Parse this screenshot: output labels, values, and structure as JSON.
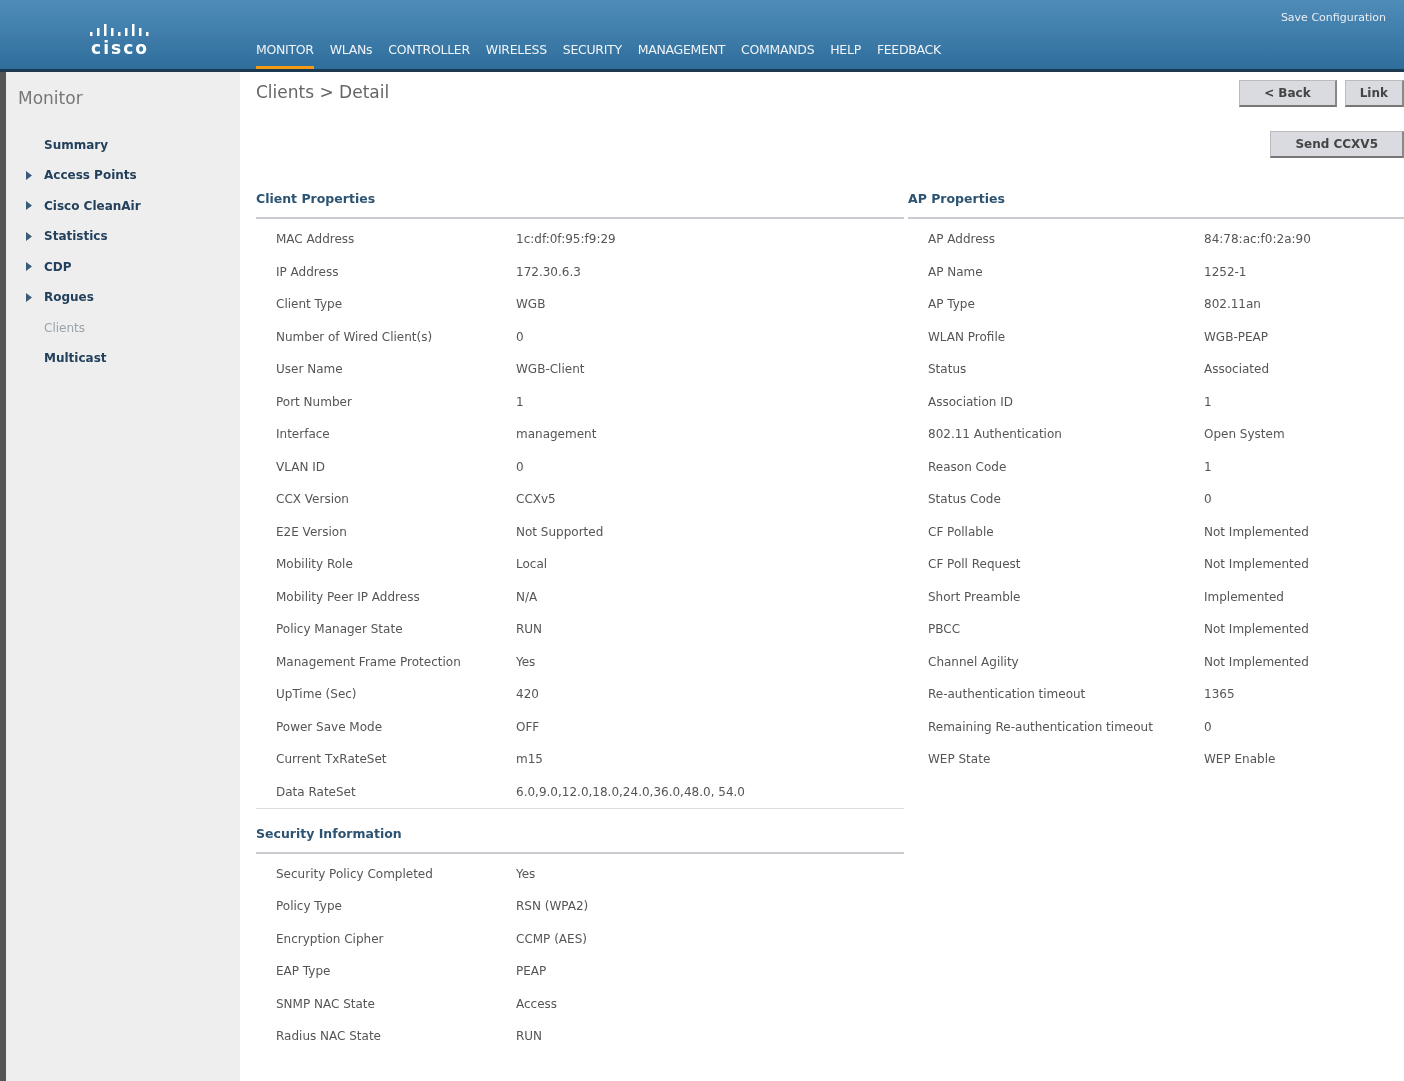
{
  "header": {
    "logo": "cisco",
    "save_link": "Save Configuration",
    "nav": [
      {
        "label": "MONITOR",
        "selected": true
      },
      {
        "label": "WLANs",
        "selected": false
      },
      {
        "label": "CONTROLLER",
        "selected": false
      },
      {
        "label": "WIRELESS",
        "selected": false
      },
      {
        "label": "SECURITY",
        "selected": false
      },
      {
        "label": "MANAGEMENT",
        "selected": false
      },
      {
        "label": "COMMANDS",
        "selected": false
      },
      {
        "label": "HELP",
        "selected": false
      },
      {
        "label": "FEEDBACK",
        "selected": false
      }
    ]
  },
  "sidebar": {
    "title": "Monitor",
    "items": [
      {
        "label": "Summary",
        "expandable": false,
        "selected": false
      },
      {
        "label": "Access Points",
        "expandable": true,
        "selected": false
      },
      {
        "label": "Cisco CleanAir",
        "expandable": true,
        "selected": false
      },
      {
        "label": "Statistics",
        "expandable": true,
        "selected": false
      },
      {
        "label": "CDP",
        "expandable": true,
        "selected": false
      },
      {
        "label": "Rogues",
        "expandable": true,
        "selected": false
      },
      {
        "label": "Clients",
        "expandable": false,
        "selected": true
      },
      {
        "label": "Multicast",
        "expandable": false,
        "selected": false
      }
    ]
  },
  "page": {
    "breadcrumb": "Clients > Detail",
    "buttons": [
      "< Back",
      "Link"
    ],
    "send_button": "Send CCXV5"
  },
  "client_properties": {
    "title": "Client Properties",
    "rows": [
      [
        "MAC Address",
        "1c:df:0f:95:f9:29"
      ],
      [
        "IP Address",
        "172.30.6.3"
      ],
      [
        "Client Type",
        "WGB"
      ],
      [
        "Number of Wired Client(s)",
        "0"
      ],
      [
        "User Name",
        "WGB-Client"
      ],
      [
        "Port Number",
        "1"
      ],
      [
        "Interface",
        "management"
      ],
      [
        "VLAN ID",
        "0"
      ],
      [
        "CCX Version",
        "CCXv5"
      ],
      [
        "E2E Version",
        "Not Supported"
      ],
      [
        "Mobility Role",
        "Local"
      ],
      [
        "Mobility Peer IP Address",
        "N/A"
      ],
      [
        "Policy Manager State",
        "RUN"
      ],
      [
        "Management Frame Protection",
        "Yes"
      ],
      [
        "UpTime (Sec)",
        "420"
      ],
      [
        "Power Save Mode",
        "OFF"
      ],
      [
        "Current TxRateSet",
        "m15"
      ],
      [
        "Data RateSet",
        "6.0,9.0,12.0,18.0,24.0,36.0,48.0, 54.0"
      ]
    ]
  },
  "ap_properties": {
    "title": "AP Properties",
    "rows": [
      [
        "AP Address",
        "84:78:ac:f0:2a:90"
      ],
      [
        "AP Name",
        "1252-1"
      ],
      [
        "AP Type",
        "802.11an"
      ],
      [
        "WLAN Profile",
        "WGB-PEAP"
      ],
      [
        "Status",
        "Associated"
      ],
      [
        "Association ID",
        "1"
      ],
      [
        "802.11 Authentication",
        "Open System"
      ],
      [
        "Reason Code",
        "1"
      ],
      [
        "Status Code",
        "0"
      ],
      [
        "CF Pollable",
        "Not Implemented"
      ],
      [
        "CF Poll Request",
        "Not Implemented"
      ],
      [
        "Short Preamble",
        "Implemented"
      ],
      [
        "PBCC",
        "Not Implemented"
      ],
      [
        "Channel Agility",
        "Not Implemented"
      ],
      [
        "Re-authentication timeout",
        "1365"
      ],
      [
        "Remaining Re-authentication timeout",
        "0"
      ],
      [
        "WEP State",
        "WEP Enable"
      ]
    ]
  },
  "security_information": {
    "title": "Security Information",
    "rows": [
      [
        "Security Policy Completed",
        "Yes"
      ],
      [
        "Policy Type",
        "RSN (WPA2)"
      ],
      [
        "Encryption Cipher",
        "CCMP (AES)"
      ],
      [
        "EAP Type",
        "PEAP"
      ],
      [
        "SNMP NAC State",
        "Access"
      ],
      [
        "Radius NAC State",
        "RUN"
      ]
    ]
  }
}
